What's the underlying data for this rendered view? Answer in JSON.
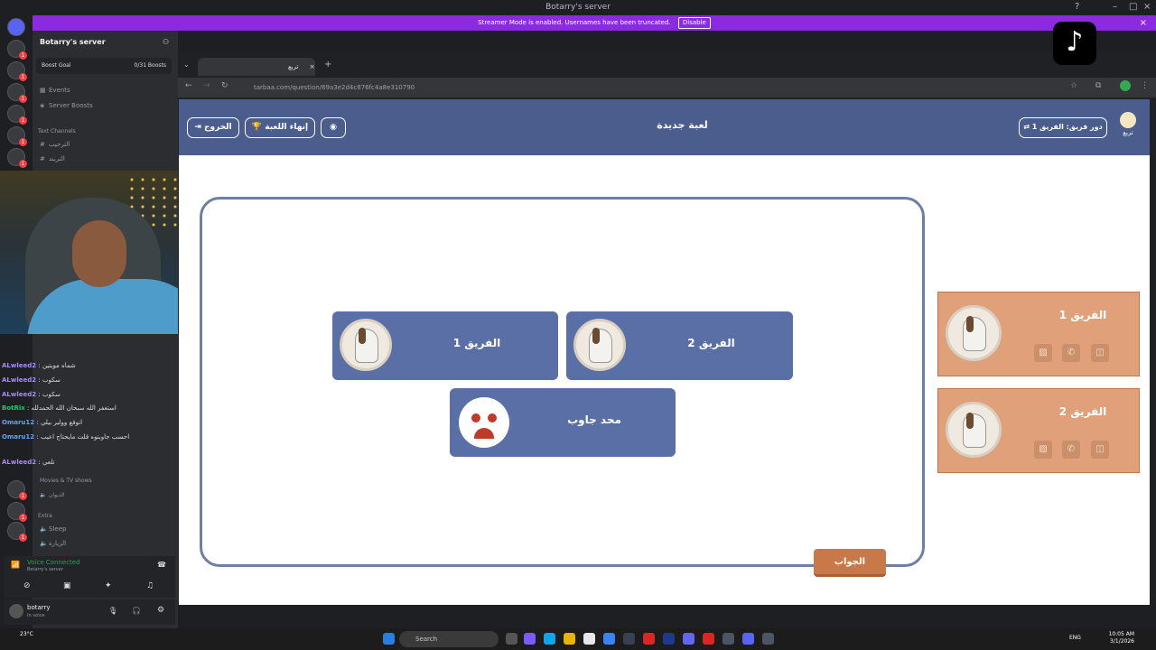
{
  "window": {
    "title": "Botarry's server"
  },
  "banner": {
    "text": "Streamer Mode is enabled. Usernames have been truncated.",
    "button": "Disable"
  },
  "sidebar": {
    "server_name": "Botarry's server",
    "boost_goal": "Boost Goal",
    "boost_count": "0/31 Boosts",
    "items": [
      {
        "label": "Events"
      },
      {
        "label": "Server Boosts"
      }
    ],
    "text_channels_header": "Text Channels",
    "text_channels": [
      "الترحيب",
      "التريند"
    ],
    "voice_items": [
      "Movies & TV shows",
      "الديوان"
    ],
    "extra_header": "Extra",
    "extra_items": [
      "Sleep",
      "الزيارة"
    ]
  },
  "chat": [
    {
      "user": "ALwleed2",
      "msg": "شماه مويتين"
    },
    {
      "user": "ALwleed2",
      "msg": "سكوب"
    },
    {
      "user": "ALwleed2",
      "msg": "سكوب"
    },
    {
      "user": "BotRix",
      "msg": "استغفر الله سبحان الله الحمدلله"
    },
    {
      "user": "Omaru12",
      "msg": "اتوقع وولير بيلي"
    },
    {
      "user": "Omaru12",
      "msg": "احسب جاوبتوه قلت مايحتاج اعيب"
    },
    {
      "user": "ALwleed2",
      "msg": "تلعي"
    }
  ],
  "voice": {
    "status": "Voice Connected",
    "server": "Botarry's server"
  },
  "user": {
    "name": "botarry",
    "status": "In voice"
  },
  "browser": {
    "tab_title": "تربع",
    "url": "tarbaa.com/question/69a3e2d4c876fc4a8e310790"
  },
  "game": {
    "header_title": "لعبة جديدة",
    "exit_button": "الخروج",
    "end_game_button": "إنهاء اللعبة",
    "turn_button": "دور فريق: الفريق 1",
    "logo_text": "تربع",
    "team1_label": "الفريق 1",
    "team2_label": "الفريق 2",
    "nobody_label": "محد جاوب",
    "answer_button": "الجواب",
    "score_team1": "الفريق 1",
    "score_team2": "الفريق 2"
  },
  "taskbar": {
    "search": "Search",
    "weather_temp": "23°C",
    "time": "10:05 AM",
    "date": "3/1/2026",
    "lang": "ENG"
  },
  "colors": {
    "header": "#4a5d8c",
    "team_card": "#5a6fa5",
    "score_card": "#e0a07a",
    "answer": "#c9784a"
  }
}
